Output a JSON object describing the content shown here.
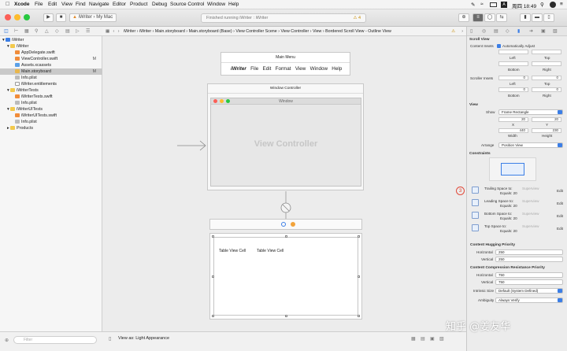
{
  "menubar": {
    "apple": "",
    "app_name": "Xcode",
    "items": [
      "File",
      "Edit",
      "View",
      "Find",
      "Navigate",
      "Editor",
      "Product",
      "Debug",
      "Source Control",
      "Window",
      "Help"
    ],
    "clock": "周四 18:49"
  },
  "toolbar": {
    "scheme": "iWriter",
    "device": "My Mac",
    "status": "Finished running iWriter : iWriter",
    "warning_count": "4"
  },
  "navigator": {
    "items": [
      {
        "label": "iWriter",
        "mark": ""
      },
      {
        "label": "iWriter",
        "mark": ""
      },
      {
        "label": "AppDelegate.swift",
        "mark": ""
      },
      {
        "label": "ViewController.swift",
        "mark": "M"
      },
      {
        "label": "Assets.xcassets",
        "mark": ""
      },
      {
        "label": "Main.storyboard",
        "mark": "M"
      },
      {
        "label": "Info.plist",
        "mark": ""
      },
      {
        "label": "iWriter.entitlements",
        "mark": ""
      },
      {
        "label": "iWriterTests",
        "mark": ""
      },
      {
        "label": "iWriterTests.swift",
        "mark": ""
      },
      {
        "label": "Info.plist",
        "mark": ""
      },
      {
        "label": "iWriterUITests",
        "mark": ""
      },
      {
        "label": "iWriterUITests.swift",
        "mark": ""
      },
      {
        "label": "Info.plist",
        "mark": ""
      },
      {
        "label": "Products",
        "mark": ""
      }
    ],
    "filter_placeholder": "Filter"
  },
  "jumpbar": {
    "crumbs": [
      "iWriter",
      "iWriter",
      "Main.storyboard",
      "Main.storyboard (Base)",
      "View Controller Scene",
      "View Controller",
      "View",
      "Bordered Scroll View - Outline View"
    ]
  },
  "canvas": {
    "main_menu_title": "Main Menu",
    "menu_items": [
      "iWriter",
      "File",
      "Edit",
      "Format",
      "View",
      "Window",
      "Help"
    ],
    "window_controller_title": "Window Controller",
    "window_title": "Window",
    "view_controller_label": "View Controller",
    "cells": [
      "Table View Cell",
      "Table View Cell"
    ]
  },
  "bottombar": {
    "view_as": "View as: Light Appearance"
  },
  "inspector": {
    "section_scroll_view": "Scroll View",
    "content_insets_label": "Content Insets",
    "automatically_adjust": "Automatically Adjust",
    "left": "Left",
    "top": "Top",
    "bottom": "Bottom",
    "right": "Right",
    "scroller_insets_label": "Scroller Insets",
    "scroller_values": [
      "0",
      "0",
      "0",
      "0"
    ],
    "section_view": "View",
    "show_label": "Show",
    "show_value": "Frame Rectangle",
    "x_value": "20",
    "y_value": "20",
    "x_label": "X",
    "y_label": "Y",
    "width_value": "440",
    "height_value": "230",
    "width_label": "Width",
    "height_label": "Height",
    "arrange_label": "Arrange",
    "arrange_value": "Position View",
    "section_constraints": "Constraints",
    "badge_number": "3",
    "constraints": [
      {
        "title": "Trailing Space to:",
        "target": "Superview",
        "equals": "Equals: 20",
        "edit": "Edit"
      },
      {
        "title": "Leading Space to:",
        "target": "Superview",
        "equals": "Equals: 20",
        "edit": "Edit"
      },
      {
        "title": "Bottom Space to:",
        "target": "Superview",
        "equals": "Equals: 20",
        "edit": "Edit"
      },
      {
        "title": "Top Space to:",
        "target": "Superview",
        "equals": "Equals: 20",
        "edit": "Edit"
      }
    ],
    "section_hugging": "Content Hugging Priority",
    "horizontal_label": "Horizontal",
    "vertical_label": "Vertical",
    "hugging_h": "250",
    "hugging_v": "250",
    "section_compression": "Content Compression Resistance Priority",
    "compression_h": "750",
    "compression_v": "750",
    "intrinsic_label": "Intrinsic Size",
    "intrinsic_value": "Default (System Defined)",
    "ambiguity_label": "Ambiguity",
    "ambiguity_value": "Always Verify"
  },
  "watermark": "知乎 @姜友华",
  "colors": {
    "accent": "#3b7ee6",
    "badge": "#e14b3b",
    "folder": "#f2c94c"
  }
}
